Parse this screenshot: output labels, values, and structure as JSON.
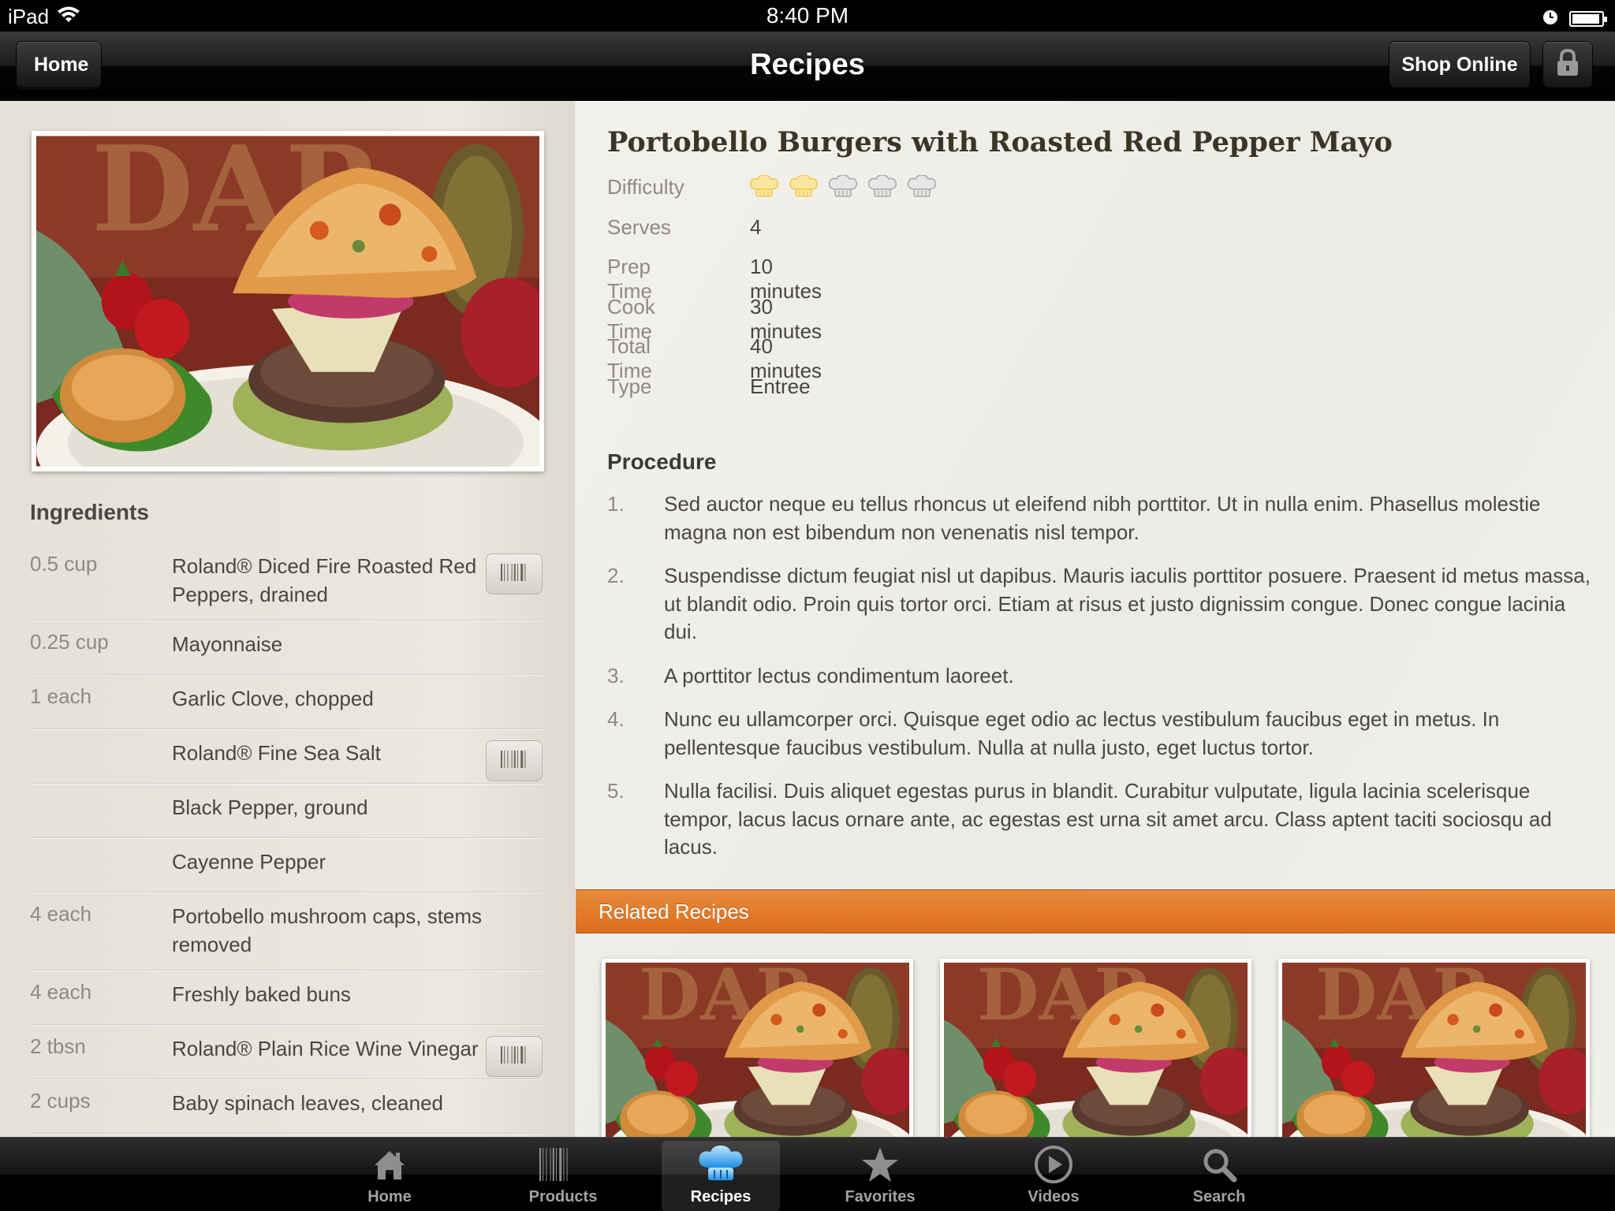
{
  "status_bar": {
    "device": "iPad",
    "time": "8:40 PM",
    "battery_level": 0.95
  },
  "nav": {
    "title": "Recipes",
    "back_label": "Home",
    "shop_label": "Shop Online",
    "lock_icon": "lock-icon"
  },
  "recipe": {
    "title": "Portobello Burgers with Roasted Red Pepper Mayo",
    "difficulty": {
      "label": "Difficulty",
      "rating": 2,
      "max": 5,
      "icon": "chef-hat-icon"
    },
    "meta": [
      {
        "label": "Serves",
        "value": "4"
      },
      {
        "label": "Prep Time",
        "value": "10 minutes"
      },
      {
        "label": "Cook Time",
        "value": "30 minutes"
      },
      {
        "label": "Total Time",
        "value": "40 minutes"
      },
      {
        "label": "Type",
        "value": "Entree"
      }
    ]
  },
  "ingredients": {
    "heading": "Ingredients",
    "items": [
      {
        "qty": "0.5 cup",
        "name": "Roland® Diced Fire Roasted Red Peppers, drained",
        "barcode": true
      },
      {
        "qty": "0.25 cup",
        "name": "Mayonnaise",
        "barcode": false
      },
      {
        "qty": "1 each",
        "name": "Garlic Clove, chopped",
        "barcode": false
      },
      {
        "qty": "",
        "name": "Roland® Fine Sea Salt",
        "barcode": true
      },
      {
        "qty": "",
        "name": "Black Pepper, ground",
        "barcode": false
      },
      {
        "qty": "",
        "name": "Cayenne Pepper",
        "barcode": false
      },
      {
        "qty": "4 each",
        "name": "Portobello mushroom caps, stems removed",
        "barcode": false
      },
      {
        "qty": "4 each",
        "name": "Freshly baked buns",
        "barcode": false
      },
      {
        "qty": "2 tbsn",
        "name": "Roland® Plain Rice Wine Vinegar",
        "barcode": true
      },
      {
        "qty": "2 cups",
        "name": "Baby spinach leaves, cleaned",
        "barcode": false
      }
    ]
  },
  "procedure": {
    "heading": "Procedure",
    "steps": [
      {
        "num": "1.",
        "text": "Sed auctor neque eu tellus rhoncus ut eleifend nibh porttitor. Ut in nulla enim. Phasellus molestie magna non est bibendum non venenatis nisl tempor."
      },
      {
        "num": "2.",
        "text": "Suspendisse dictum feugiat nisl ut dapibus. Mauris iaculis porttitor posuere. Praesent id metus massa, ut blandit odio. Proin quis tortor orci. Etiam at risus et justo dignissim congue. Donec congue lacinia dui."
      },
      {
        "num": "3.",
        "text": "A porttitor lectus condimentum laoreet."
      },
      {
        "num": "4.",
        "text": "Nunc eu ullamcorper orci. Quisque eget odio ac lectus vestibulum faucibus eget in metus. In pellentesque faucibus vestibulum. Nulla at nulla justo, eget luctus tortor."
      },
      {
        "num": "5.",
        "text": "Nulla facilisi. Duis aliquet egestas purus in blandit. Curabitur vulputate, ligula lacinia scelerisque tempor, lacus lacus ornare ante, ac egestas est urna sit amet arcu. Class aptent taciti sociosqu ad lacus."
      }
    ]
  },
  "related": {
    "heading": "Related Recipes",
    "count": 3
  },
  "tabs": [
    {
      "label": "Home",
      "icon": "house-icon",
      "active": false
    },
    {
      "label": "Products",
      "icon": "barcode-icon",
      "active": false
    },
    {
      "label": "Recipes",
      "icon": "chef-hat-icon",
      "active": true
    },
    {
      "label": "Favorites",
      "icon": "star-icon",
      "active": false
    },
    {
      "label": "Videos",
      "icon": "play-icon",
      "active": false
    },
    {
      "label": "Search",
      "icon": "magnifier-icon",
      "active": false
    }
  ],
  "colors": {
    "accent_orange": "#e0741f",
    "hat_active": "#f2c94c",
    "hat_inactive": "#c9c9c9"
  }
}
